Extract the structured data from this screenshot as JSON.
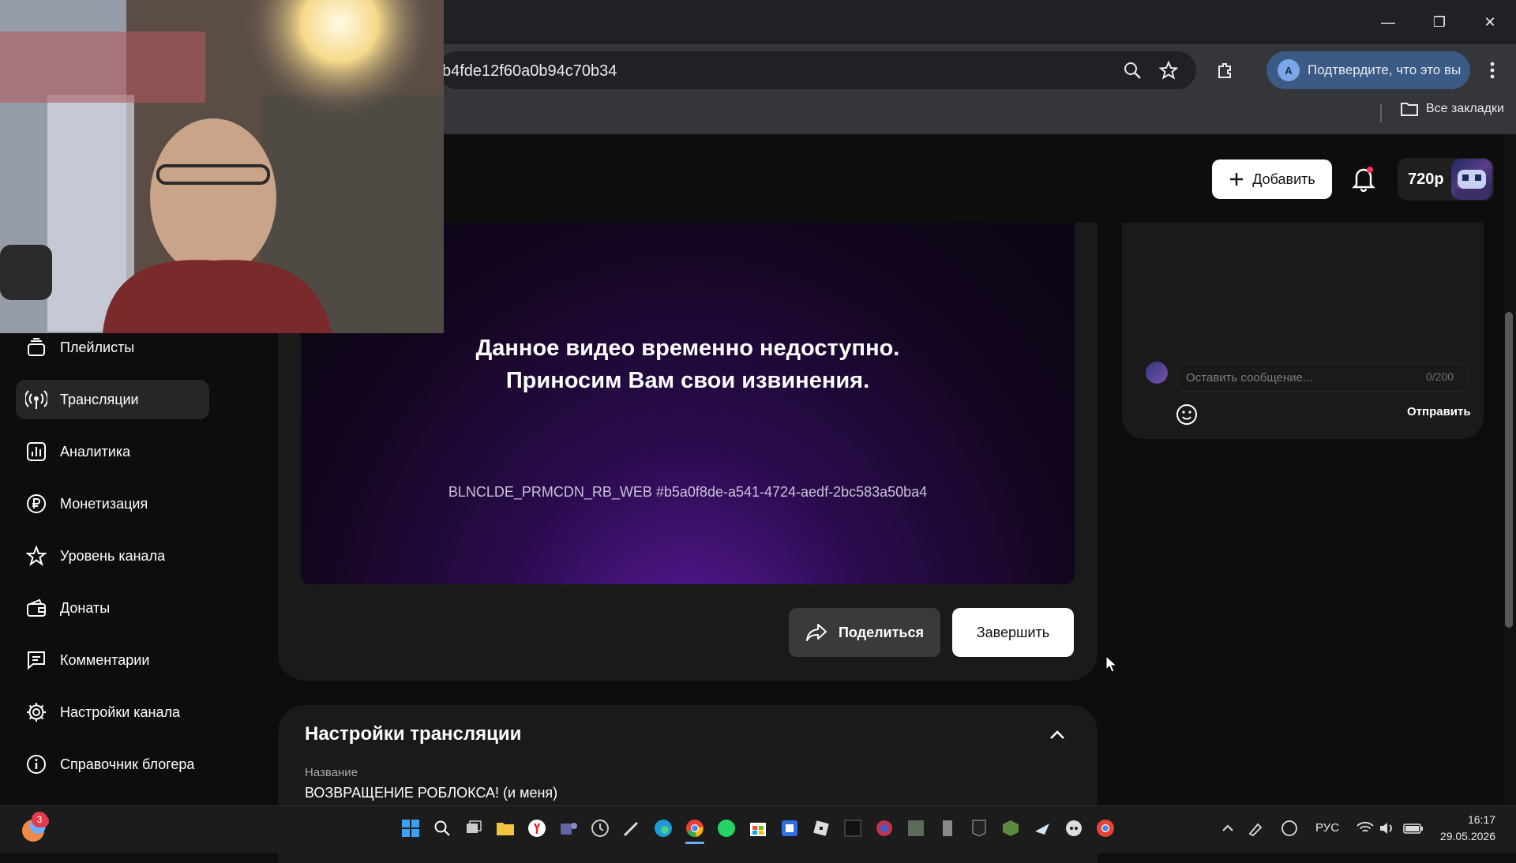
{
  "browser": {
    "url_fragment": "b4fde12f60a0b94c70b34",
    "profile_label": "Подтвердите, что это вы",
    "profile_initial": "A",
    "all_bookmarks": "Все закладки"
  },
  "header": {
    "add_label": "Добавить",
    "quality": "720p"
  },
  "sidebar": {
    "items": [
      {
        "label": "Плейлисты",
        "icon": "playlist-icon"
      },
      {
        "label": "Трансляции",
        "icon": "broadcast-icon",
        "active": true
      },
      {
        "label": "Аналитика",
        "icon": "analytics-icon"
      },
      {
        "label": "Монетизация",
        "icon": "ruble-icon"
      },
      {
        "label": "Уровень канала",
        "icon": "star-icon"
      },
      {
        "label": "Донаты",
        "icon": "wallet-icon"
      },
      {
        "label": "Комментарии",
        "icon": "comment-icon"
      },
      {
        "label": "Настройки канала",
        "icon": "gear-icon"
      },
      {
        "label": "Справочник блогера",
        "icon": "info-icon"
      }
    ]
  },
  "player": {
    "message_line1": "Данное видео временно недоступно.",
    "message_line2": "Приносим Вам свои извинения.",
    "error_code": "BLNCLDE_PRMCDN_RB_WEB #b5a0f8de-a541-4724-aedf-2bc583a50ba4",
    "share_label": "Поделиться",
    "finish_label": "Завершить"
  },
  "settings": {
    "title": "Настройки трансляции",
    "name_label": "Название",
    "name_value": "ВОЗВРАЩЕНИЕ РОБЛОКСА! (и меня)"
  },
  "chat": {
    "placeholder": "Оставить сообщение...",
    "counter": "0/200",
    "send_label": "Отправить"
  },
  "taskbar": {
    "notification_count": "3",
    "language": "РУС",
    "time": "16:17",
    "date": "29.05.2026"
  }
}
